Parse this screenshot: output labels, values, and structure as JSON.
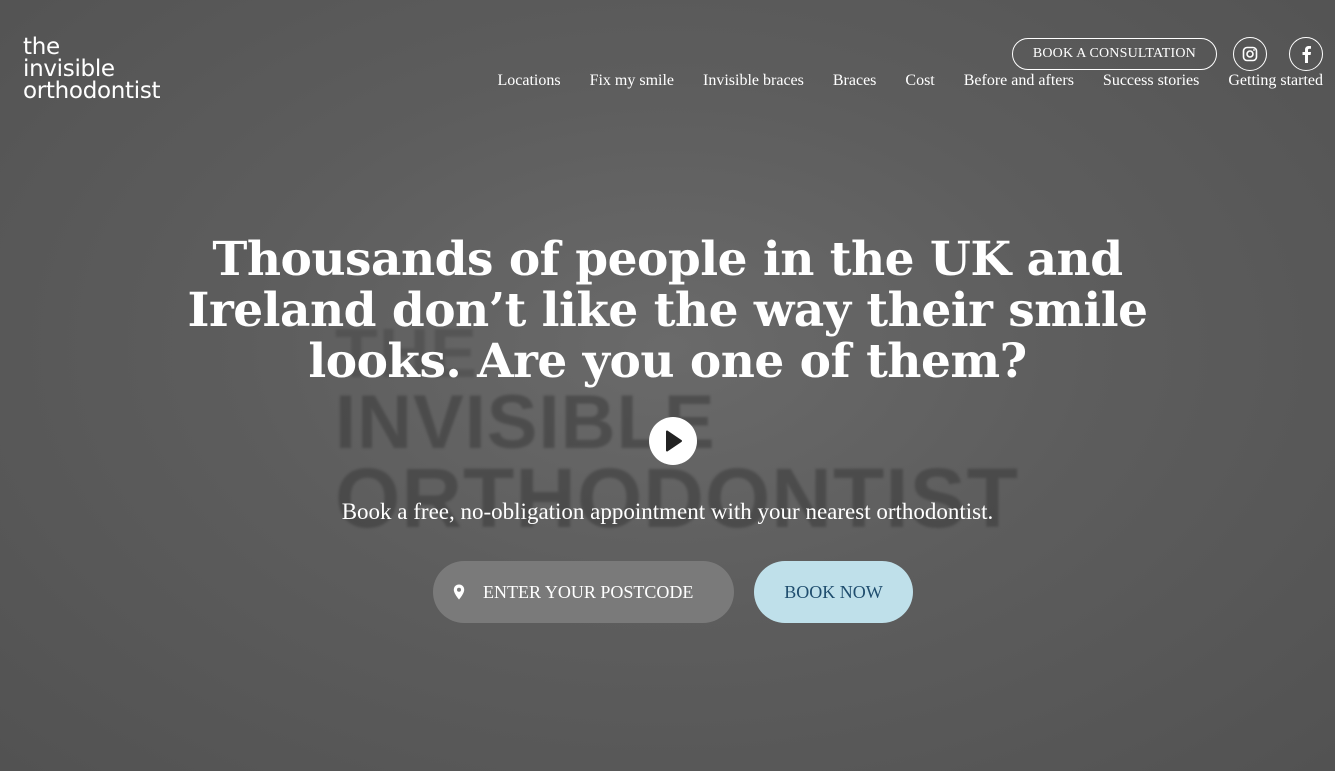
{
  "logo": {
    "line1": "the",
    "line2": "invisible",
    "line3": "orthodontist"
  },
  "header": {
    "consult_label": "BOOK A CONSULTATION",
    "social": [
      "instagram-icon",
      "facebook-icon"
    ]
  },
  "nav": {
    "items": [
      {
        "label": "Locations"
      },
      {
        "label": "Fix my smile"
      },
      {
        "label": "Invisible braces"
      },
      {
        "label": "Braces"
      },
      {
        "label": "Cost"
      },
      {
        "label": "Before and afters"
      },
      {
        "label": "Success stories"
      },
      {
        "label": "Getting started"
      }
    ]
  },
  "video_background": {
    "line1": "THE",
    "line2": "INVISIBLE",
    "line3": "ORTHODONTIST"
  },
  "hero": {
    "headline": "Thousands of people in the UK and Ireland don’t like the way their smile looks. Are you one of them?",
    "play_icon": "play-icon",
    "subtext": "Book a free, no-obligation appointment with your nearest orthodontist.",
    "postcode_placeholder": "ENTER YOUR POSTCODE",
    "location_icon": "location-pin-icon",
    "book_label": "BOOK NOW"
  },
  "colors": {
    "background": "#5e5e5e",
    "book_button": "#bfe0ea",
    "book_text": "#1f4d6e",
    "input_bg": "#7a7a7a"
  }
}
